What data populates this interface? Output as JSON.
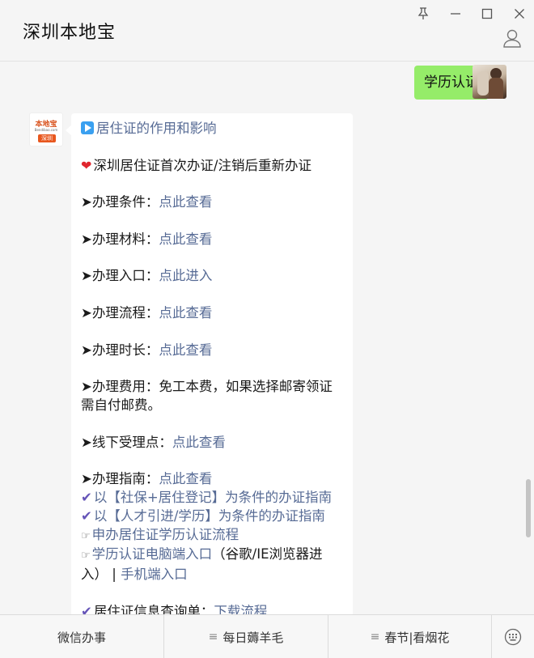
{
  "window": {
    "title": "深圳本地宝",
    "controls": [
      "pin-icon",
      "minimize-icon",
      "maximize-icon",
      "close-icon"
    ]
  },
  "chat": {
    "outgoing": {
      "text": "学历认证"
    },
    "sender_logo": {
      "brand": "本地宝",
      "domain": "Bendibao.com",
      "city": "深圳"
    },
    "incoming": {
      "heading": "居住证的作用和影响",
      "section_title": "深圳居住证首次办证/注销后重新办证",
      "items": [
        {
          "prefix": "➤办理条件：",
          "link": "点此查看"
        },
        {
          "prefix": "➤办理材料：",
          "link": "点此查看"
        },
        {
          "prefix": "➤办理入口：",
          "link": "点此进入"
        },
        {
          "prefix": "➤办理流程：",
          "link": "点此查看"
        },
        {
          "prefix": "➤办理时长：",
          "link": "点此查看"
        }
      ],
      "fee_line1": "➤办理费用：免工本费，如果选择邮寄领证",
      "fee_line2": "需自付邮费。",
      "offline": {
        "prefix": "➤线下受理点：",
        "link": "点此查看"
      },
      "guide": {
        "prefix": "➤办理指南：",
        "link": "点此查看"
      },
      "guide_links": [
        "以【社保+居住登记】为条件的办证指南",
        "以【人才引进/学历】为条件的办证指南"
      ],
      "flow_link": "申办居住证学历认证流程",
      "pc_entry": {
        "link": "学历认证电脑端入口",
        "note1": "（谷歌/IE浏览器进",
        "note2": "入）",
        "sep": "|",
        "mobile_link": "手机端入口"
      },
      "selfcheck": {
        "prefix": "居住证信息查询单：",
        "link": "下载流程"
      }
    }
  },
  "bottom_menu": {
    "items": [
      "微信办事",
      "每日薅羊毛",
      "春节|看烟花"
    ],
    "keyboard_icon": "keyboard-icon"
  },
  "colors": {
    "background": "#f5f5f5",
    "outgoing_bubble": "#95ec69",
    "link": "#576b95",
    "heart": "#e0262e",
    "check": "#6655b8"
  }
}
